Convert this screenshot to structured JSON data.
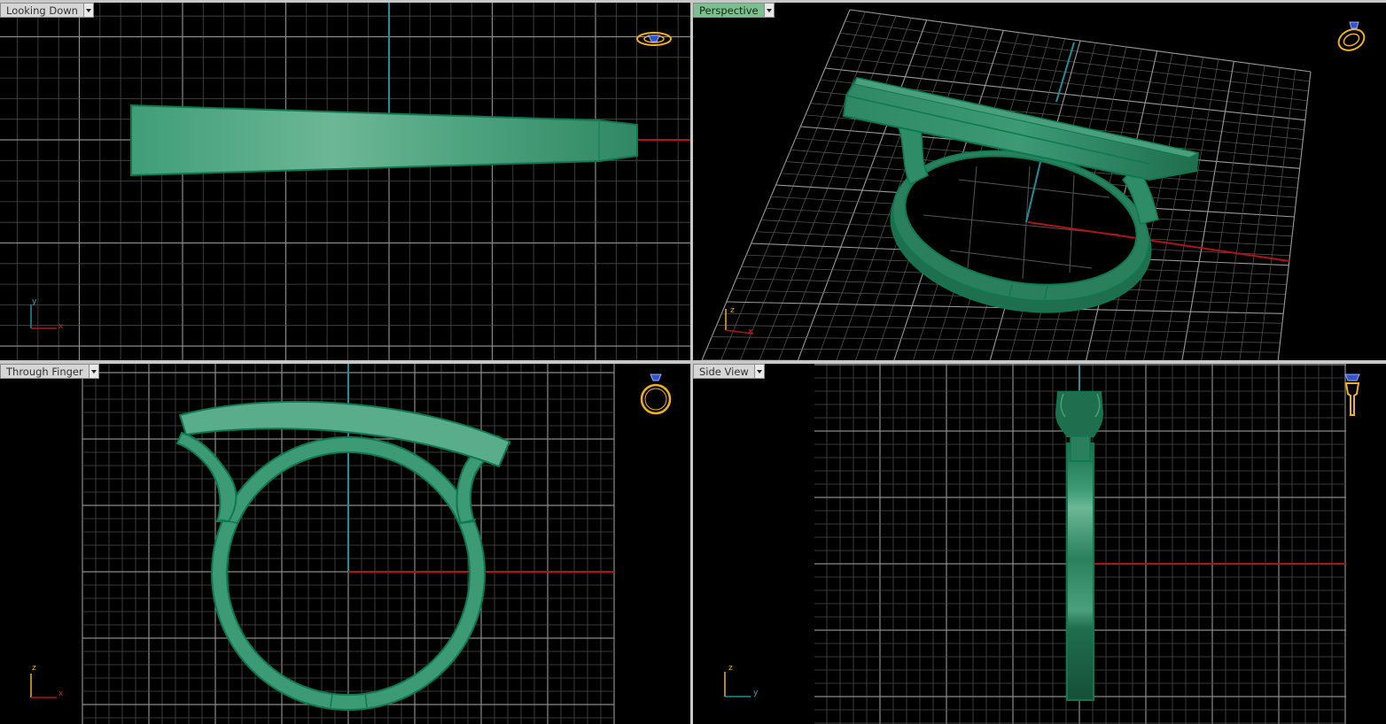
{
  "viewports": {
    "top": {
      "label": "Looking Down",
      "axis_h": "x",
      "axis_v": "y",
      "active": false
    },
    "persp": {
      "label": "Perspective",
      "axis_h": "x",
      "axis_v": "z",
      "active": true
    },
    "front": {
      "label": "Through Finger",
      "axis_h": "x",
      "axis_v": "z",
      "active": false
    },
    "side": {
      "label": "Side View",
      "axis_h": "y",
      "axis_v": "z",
      "active": false
    }
  },
  "colors": {
    "background": "#000000",
    "grid": "#6b6b6b",
    "axis_x": "#b01414",
    "axis_y": "#1f8f9a",
    "model_fill": "#3c9a75",
    "model_edge": "#0c7a50",
    "active_tab": "#7fbf8f",
    "nav_icon": "#f0b020",
    "gem": "#3355cc"
  },
  "icons": {
    "view_nav": "ring-view-icon",
    "dropdown": "chevron-down-icon"
  }
}
